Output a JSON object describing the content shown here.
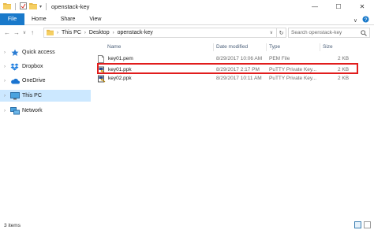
{
  "window": {
    "title": "openstack-key"
  },
  "ribbon": {
    "tabs": [
      "File",
      "Home",
      "Share",
      "View"
    ]
  },
  "address": {
    "crumbs": [
      "This PC",
      "Desktop",
      "openstack-key"
    ],
    "search_placeholder": "Search openstack-key"
  },
  "nav": {
    "items": [
      {
        "label": "Quick access",
        "icon": "star-icon"
      },
      {
        "label": "Dropbox",
        "icon": "dropbox-icon"
      },
      {
        "label": "OneDrive",
        "icon": "cloud-icon"
      },
      {
        "label": "This PC",
        "icon": "computer-icon"
      },
      {
        "label": "Network",
        "icon": "network-icon"
      }
    ]
  },
  "files": {
    "columns": [
      "Name",
      "Date modified",
      "Type",
      "Size"
    ],
    "rows": [
      {
        "name": "key01.pem",
        "date": "8/29/2017 10:06 AM",
        "type": "PEM File",
        "size": "2 KB",
        "icon": "document-icon"
      },
      {
        "name": "key01.ppk",
        "date": "8/29/2017 2:17 PM",
        "type": "PuTTY Private Key...",
        "size": "2 KB",
        "icon": "putty-key-icon"
      },
      {
        "name": "key02.ppk",
        "date": "8/29/2017 10:11 AM",
        "type": "PuTTY Private Key...",
        "size": "2 KB",
        "icon": "putty-key-icon"
      }
    ]
  },
  "status": {
    "items_text": "3 items"
  },
  "colors": {
    "file_tab": "#1979ca",
    "selection": "#cce8ff",
    "highlight_box": "#e11d1d"
  }
}
